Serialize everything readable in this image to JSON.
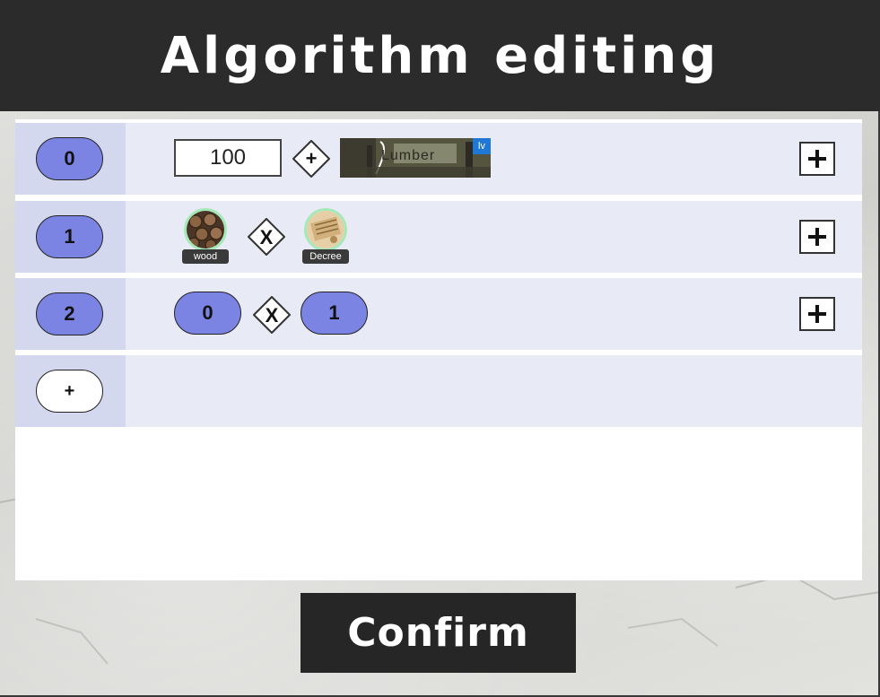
{
  "title": "Algorithm editing",
  "rows": [
    {
      "index": "0",
      "value": "100",
      "operator": "+",
      "building": {
        "name": "Lumberyard",
        "badge": "lv",
        "name_visible": "Lumber"
      }
    },
    {
      "index": "1",
      "operator": "X",
      "resources": [
        {
          "label": "wood",
          "icon": "wood-logs-icon"
        },
        {
          "label": "Decree",
          "icon": "decree-scroll-icon"
        }
      ]
    },
    {
      "index": "2",
      "left": "0",
      "operator": "X",
      "right": "1"
    }
  ],
  "add_row_label": "+",
  "confirm_label": "Confirm",
  "colors": {
    "title_bar": "#2b2b2b",
    "row_bg": "#e8ebf6",
    "index_cell_bg": "#d3d8ee",
    "pill": "#7b84e2",
    "resource_ring": "#a6e9b8",
    "level_badge": "#1f78d6"
  }
}
